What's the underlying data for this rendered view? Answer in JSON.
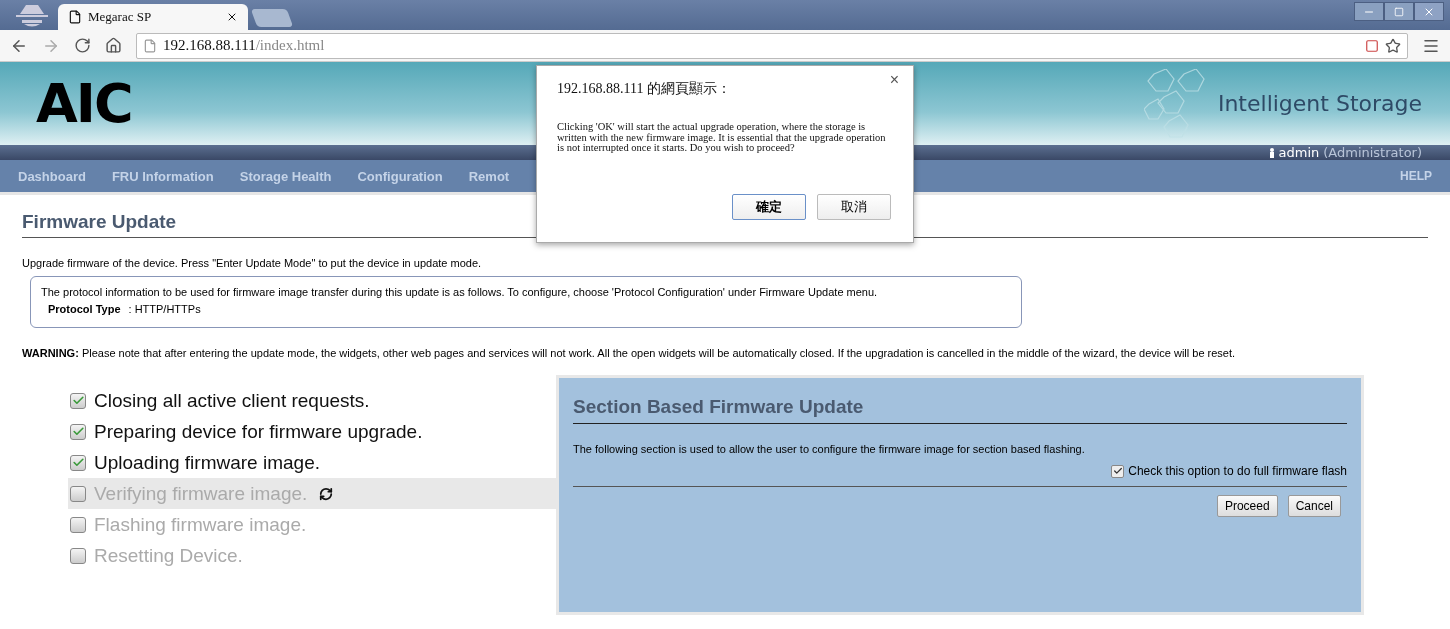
{
  "browser": {
    "tabs": [
      {
        "title": "Megarac SP",
        "selected": true
      }
    ],
    "address": {
      "host": "192.168.88.111",
      "path": "/index.html"
    }
  },
  "header": {
    "logo": "AIC",
    "brand": "Intelligent Storage",
    "user": "admin",
    "role": "(Administrator)"
  },
  "nav": {
    "items": [
      "Dashboard",
      "FRU Information",
      "Storage Health",
      "Configuration",
      "Remot"
    ],
    "help": "HELP"
  },
  "page": {
    "title": "Firmware Update",
    "intro": "Upgrade firmware of the device. Press \"Enter Update Mode\" to put the device in update mode.",
    "protocol_info": "The protocol information to be used for firmware image transfer during this update is as follows. To configure, choose 'Protocol Configuration' under Firmware Update menu.",
    "protocol_label": "Protocol Type",
    "protocol_value": ": HTTP/HTTPs",
    "warning": "**WARNING:** Please note that after entering the update mode, the widgets, other web pages and services will not work. All the open widgets will be automatically closed. If the upgradation is cancelled in the middle of the wizard, the device will be reset."
  },
  "steps": [
    {
      "label": "Closing all active client requests.",
      "checked": true,
      "current": false
    },
    {
      "label": "Preparing device for firmware upgrade.",
      "checked": true,
      "current": false
    },
    {
      "label": "Uploading firmware image.",
      "checked": true,
      "current": false
    },
    {
      "label": "Verifying firmware image.",
      "checked": false,
      "current": true
    },
    {
      "label": "Flashing firmware image.",
      "checked": false,
      "current": false
    },
    {
      "label": "Resetting Device.",
      "checked": false,
      "current": false
    }
  ],
  "section": {
    "title": "Section Based Firmware Update",
    "description": "The following section is used to allow the user to configure the firmware image for section based flashing.",
    "option": {
      "label": "Check this option to do full firmware flash",
      "checked": true
    },
    "buttons": [
      "Proceed",
      "Cancel"
    ]
  },
  "dialog": {
    "title": "192.168.88.111 的網頁顯示：",
    "message": "Clicking 'OK' will start the actual upgrade operation, where the storage is written with the new firmware image. It is essential that the upgrade operation is not interrupted once it starts. Do you wish to proceed?",
    "close": "×",
    "buttons": [
      {
        "label": "確定",
        "kind": "primary"
      },
      {
        "label": "取消",
        "kind": "secondary"
      }
    ]
  }
}
